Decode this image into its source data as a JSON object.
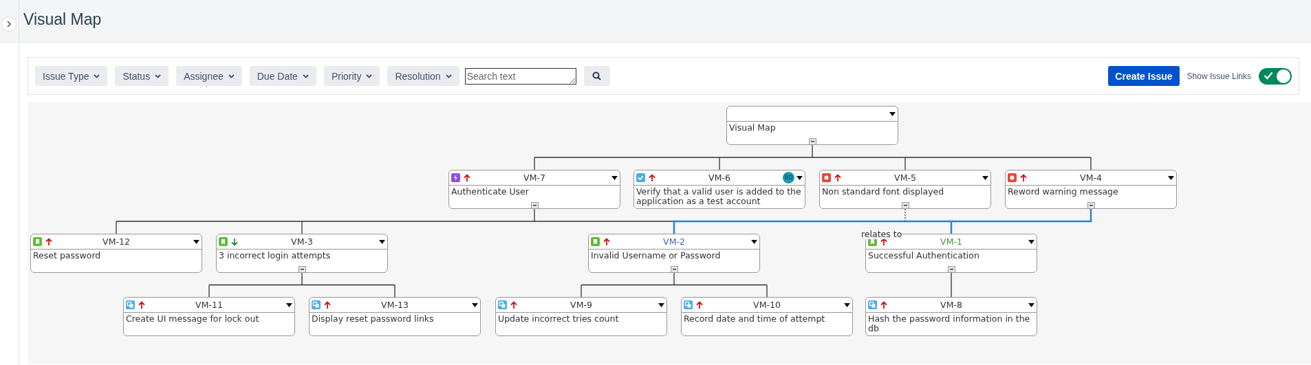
{
  "page": {
    "title": "Visual Map"
  },
  "filters": [
    {
      "label": "Issue Type"
    },
    {
      "label": "Status"
    },
    {
      "label": "Assignee"
    },
    {
      "label": "Due Date"
    },
    {
      "label": "Priority"
    },
    {
      "label": "Resolution"
    }
  ],
  "search": {
    "placeholder": "Search text"
  },
  "create_button": "Create Issue",
  "show_issue_links": {
    "label": "Show Issue Links",
    "on": true
  },
  "issue_link_label": "relates to",
  "map": {
    "summary": "Visual Map",
    "collapse_button": true,
    "children": [
      {
        "key": "VM-7",
        "kind": "epic",
        "high_priority": true,
        "color": "#333333",
        "summary": "Authenticate User",
        "collapse_button": true,
        "children": [
          {
            "key": "VM-12",
            "kind": "story",
            "high_priority": true,
            "color": "#333333",
            "summary": "Reset password",
            "collapse_button": false
          },
          {
            "key": "VM-3",
            "kind": "story",
            "high_priority": false,
            "color": "#333333",
            "summary": "3 incorrect login attempts",
            "collapse_button": true,
            "children": [
              {
                "key": "VM-11",
                "kind": "subtask",
                "high_priority": true,
                "color": "#333333",
                "summary": "Create UI message for lock out",
                "collapse_button": false
              },
              {
                "key": "VM-13",
                "kind": "subtask",
                "high_priority": true,
                "color": "#333333",
                "summary": "Display reset password links",
                "collapse_button": false
              }
            ]
          },
          {
            "key": "VM-2",
            "kind": "story",
            "high_priority": true,
            "color": "#4b5fc0",
            "summary": "Invalid Username or Password",
            "collapse_button": true,
            "children": [
              {
                "key": "VM-9",
                "kind": "subtask",
                "high_priority": true,
                "color": "#333333",
                "summary": "Update incorrect tries count",
                "collapse_button": false
              },
              {
                "key": "VM-10",
                "kind": "subtask",
                "high_priority": true,
                "color": "#333333",
                "summary": "Record date and time of attempt",
                "collapse_button": false
              }
            ]
          }
        ]
      },
      {
        "key": "VM-6",
        "kind": "task",
        "high_priority": true,
        "color": "#333333",
        "avatar": "BD",
        "summary": "Verify that a valid user is added to the application as a test account",
        "collapse_button": false
      },
      {
        "key": "VM-5",
        "kind": "bug",
        "high_priority": true,
        "color": "#333333",
        "summary": "Non standard font displayed",
        "collapse_button": true,
        "children": [
          {
            "key": "VM-1",
            "kind": "story",
            "high_priority": true,
            "color": "#3d9a3d",
            "dotted_link": true,
            "summary": "Successful Authentication",
            "collapse_button": true,
            "children": [
              {
                "key": "VM-8",
                "kind": "subtask",
                "high_priority": true,
                "color": "#333333",
                "summary": "Hash the password information in the db",
                "collapse_button": false
              }
            ]
          }
        ]
      },
      {
        "key": "VM-4",
        "kind": "bug",
        "high_priority": true,
        "color": "#333333",
        "summary": "Reword warning message",
        "collapse_button": true
      }
    ]
  }
}
